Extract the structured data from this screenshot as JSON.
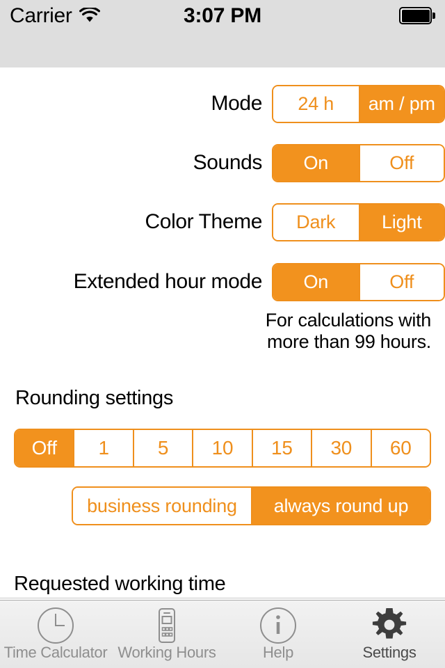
{
  "status_bar": {
    "carrier": "Carrier",
    "wifi_icon": "wifi-icon",
    "time": "3:07 PM",
    "battery_icon": "battery-full-icon"
  },
  "settings": {
    "rows": [
      {
        "label": "Mode",
        "options": [
          {
            "label": "24 h",
            "selected": false
          },
          {
            "label": "am / pm",
            "selected": true
          }
        ]
      },
      {
        "label": "Sounds",
        "options": [
          {
            "label": "On",
            "selected": true
          },
          {
            "label": "Off",
            "selected": false
          }
        ]
      },
      {
        "label": "Color Theme",
        "options": [
          {
            "label": "Dark",
            "selected": false
          },
          {
            "label": "Light",
            "selected": true
          }
        ]
      },
      {
        "label": "Extended hour mode",
        "options": [
          {
            "label": "On",
            "selected": true
          },
          {
            "label": "Off",
            "selected": false
          }
        ]
      }
    ],
    "extended_hint_line1": "For calculations with",
    "extended_hint_line2": "more than 99 hours."
  },
  "rounding": {
    "section_title": "Rounding settings",
    "intervals": [
      {
        "label": "Off",
        "selected": true
      },
      {
        "label": "1",
        "selected": false
      },
      {
        "label": "5",
        "selected": false
      },
      {
        "label": "10",
        "selected": false
      },
      {
        "label": "15",
        "selected": false
      },
      {
        "label": "30",
        "selected": false
      },
      {
        "label": "60",
        "selected": false
      }
    ],
    "modes": [
      {
        "label": "business rounding",
        "selected": false
      },
      {
        "label": "always round up",
        "selected": true
      }
    ]
  },
  "requested_working_time": {
    "section_title": "Requested working time"
  },
  "tab_bar": {
    "tabs": [
      {
        "label": "Time Calculator",
        "icon": "clock-icon",
        "active": false
      },
      {
        "label": "Working Hours",
        "icon": "calculator-icon",
        "active": false
      },
      {
        "label": "Help",
        "icon": "info-icon",
        "active": false
      },
      {
        "label": "Settings",
        "icon": "gear-icon",
        "active": true
      }
    ]
  },
  "colors": {
    "accent": "#f2921e",
    "accent_border": "#ef8f1c",
    "status_bar_bg": "#dedede",
    "tab_inactive": "#8e8e8e",
    "tab_active": "#4a4a4a"
  }
}
